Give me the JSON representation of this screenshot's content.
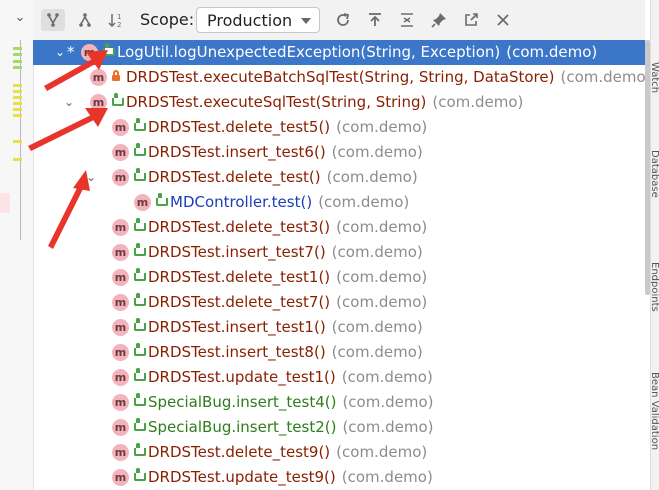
{
  "toolbar": {
    "scope_label": "Scope:",
    "scope_value": "Production"
  },
  "tree": {
    "rows": [
      {
        "name": "LogUtil.logUnexpectedException(String, Exception)",
        "pkg": "(com.demo)",
        "color": "selected",
        "vis": "public"
      },
      {
        "name": "DRDSTest.executeBatchSqlTest(String, String, DataStore)",
        "pkg": "(com.demo",
        "color": "red",
        "vis": "private"
      },
      {
        "name": "DRDSTest.executeSqlTest(String, String)",
        "pkg": "(com.demo)",
        "color": "red",
        "vis": "public"
      },
      {
        "name": "DRDSTest.delete_test5()",
        "pkg": "(com.demo)",
        "color": "red",
        "vis": "public"
      },
      {
        "name": "DRDSTest.insert_test6()",
        "pkg": "(com.demo)",
        "color": "red",
        "vis": "public"
      },
      {
        "name": "DRDSTest.delete_test()",
        "pkg": "(com.demo)",
        "color": "red",
        "vis": "public"
      },
      {
        "name": "MDController.test()",
        "pkg": "(com.demo)",
        "color": "blue",
        "vis": "public"
      },
      {
        "name": "DRDSTest.delete_test3()",
        "pkg": "(com.demo)",
        "color": "red",
        "vis": "public"
      },
      {
        "name": "DRDSTest.insert_test7()",
        "pkg": "(com.demo)",
        "color": "red",
        "vis": "public"
      },
      {
        "name": "DRDSTest.delete_test1()",
        "pkg": "(com.demo)",
        "color": "red",
        "vis": "public"
      },
      {
        "name": "DRDSTest.delete_test7()",
        "pkg": "(com.demo)",
        "color": "red",
        "vis": "public"
      },
      {
        "name": "DRDSTest.insert_test1()",
        "pkg": "(com.demo)",
        "color": "red",
        "vis": "public"
      },
      {
        "name": "DRDSTest.insert_test8()",
        "pkg": "(com.demo)",
        "color": "red",
        "vis": "public"
      },
      {
        "name": "DRDSTest.update_test1()",
        "pkg": "(com.demo)",
        "color": "red",
        "vis": "public"
      },
      {
        "name": "SpecialBug.insert_test4()",
        "pkg": "(com.demo)",
        "color": "green",
        "vis": "public"
      },
      {
        "name": "SpecialBug.insert_test2()",
        "pkg": "(com.demo)",
        "color": "green",
        "vis": "public"
      },
      {
        "name": "DRDSTest.delete_test9()",
        "pkg": "(com.demo)",
        "color": "red",
        "vis": "public"
      },
      {
        "name": "DRDSTest.update_test9()",
        "pkg": "(com.demo)",
        "color": "red",
        "vis": "public"
      }
    ],
    "row0_marker": "*",
    "method_icon_letter": "m"
  },
  "side_tabs": [
    "Watch",
    "Database",
    "Endpoints",
    "Bean Validation"
  ]
}
